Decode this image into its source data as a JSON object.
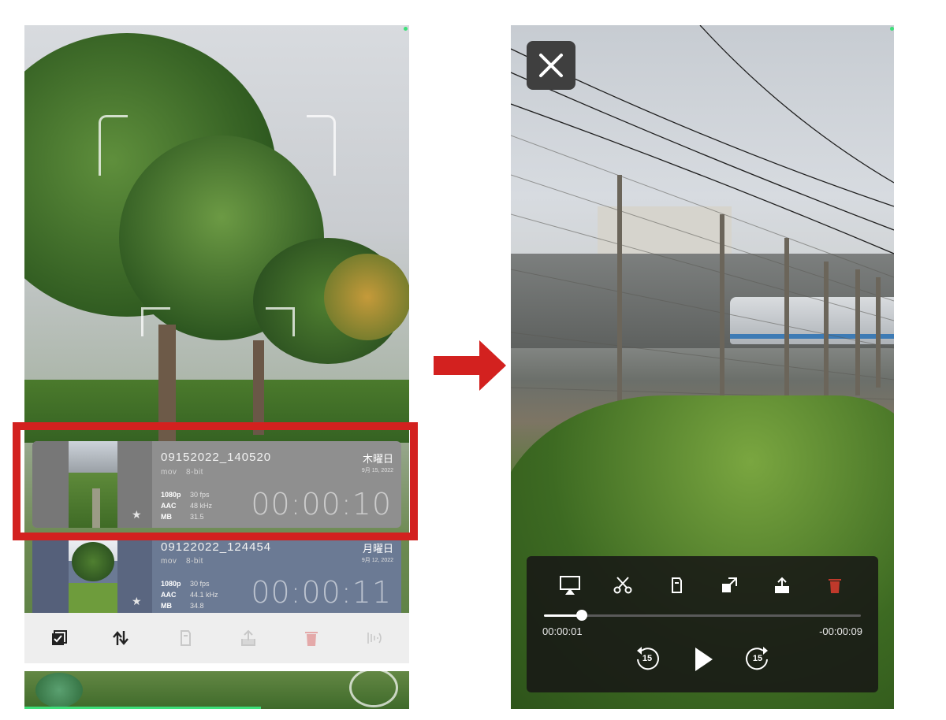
{
  "left_screen": {
    "recordings": [
      {
        "filename": "09152022_140520",
        "format": "mov",
        "bit_depth": "8-bit",
        "resolution": "1080p",
        "fps": "30 fps",
        "audio_codec": "AAC",
        "sample_rate": "48 kHz",
        "size_unit": "MB",
        "size_value": "31.5",
        "weekday": "木曜日",
        "date": "9月 15, 2022",
        "duration": "00:00:10",
        "starred_icon": "star-icon",
        "highlighted": true,
        "color": "#8f8f8f"
      },
      {
        "filename": "09122022_124454",
        "format": "mov",
        "bit_depth": "8-bit",
        "resolution": "1080p",
        "fps": "30 fps",
        "audio_codec": "AAC",
        "sample_rate": "44.1 kHz",
        "size_unit": "MB",
        "size_value": "34.8",
        "weekday": "月曜日",
        "date": "9月 12, 2022",
        "duration": "00:00:11",
        "starred_icon": "star-icon",
        "highlighted": false,
        "color": "#6b7a94"
      }
    ],
    "toolbar": [
      {
        "icon": "select-checkbox-icon",
        "enabled": true
      },
      {
        "icon": "sort-arrows-icon",
        "enabled": true
      },
      {
        "icon": "clip-icon",
        "enabled": false
      },
      {
        "icon": "share-icon",
        "enabled": false
      },
      {
        "icon": "trash-icon",
        "enabled": false
      },
      {
        "icon": "audio-waves-icon",
        "enabled": false
      }
    ],
    "highlight_color": "#d3211f"
  },
  "transition_arrow": {
    "icon": "right-arrow-icon",
    "color": "#d3211f"
  },
  "right_screen": {
    "close_icon": "close-icon",
    "player": {
      "buttons": [
        {
          "icon": "airplay-icon"
        },
        {
          "icon": "scissors-icon"
        },
        {
          "icon": "clip-icon"
        },
        {
          "icon": "resize-icon"
        },
        {
          "icon": "share-icon"
        },
        {
          "icon": "trash-icon",
          "color": "#c0392b"
        }
      ],
      "elapsed": "00:00:01",
      "remaining": "-00:00:09",
      "progress_fraction": 0.12,
      "skip_back": "15",
      "skip_forward": "15",
      "play_icon": "play-icon"
    }
  }
}
